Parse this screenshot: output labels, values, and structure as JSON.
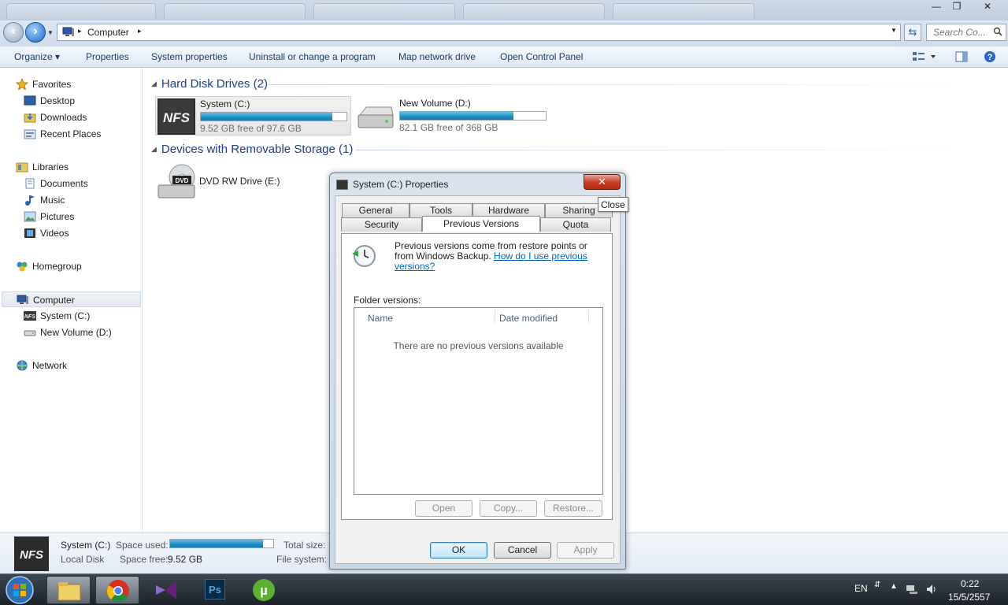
{
  "window": {
    "controls": [
      "—",
      "❐",
      "✕"
    ]
  },
  "address": {
    "crumb": "Computer",
    "search_placeholder": "Search Co..."
  },
  "toolbar": {
    "organize": "Organize ▾",
    "properties": "Properties",
    "system_properties": "System properties",
    "uninstall": "Uninstall or change a program",
    "map_drive": "Map network drive",
    "control_panel": "Open Control Panel"
  },
  "nav": {
    "favorites": "Favorites",
    "desktop": "Desktop",
    "downloads": "Downloads",
    "recent": "Recent Places",
    "libraries": "Libraries",
    "documents": "Documents",
    "music": "Music",
    "pictures": "Pictures",
    "videos": "Videos",
    "homegroup": "Homegroup",
    "computer": "Computer",
    "system_c": "System (C:)",
    "new_volume": "New Volume (D:)",
    "network": "Network"
  },
  "content": {
    "hdd_header": "Hard Disk Drives (2)",
    "removable_header": "Devices with Removable Storage (1)",
    "drives": [
      {
        "name": "System (C:)",
        "free": "9.52 GB free of 97.6 GB",
        "used_fraction": 0.9
      },
      {
        "name": "New Volume (D:)",
        "free": "82.1 GB free of 368 GB",
        "used_fraction": 0.78
      }
    ],
    "dvd": {
      "name": "DVD RW Drive (E:)",
      "badge": "DVD"
    }
  },
  "details": {
    "name": "System (C:)",
    "type": "Local Disk",
    "space_used_label": "Space used:",
    "space_free_label": "Space free:",
    "space_free_value": "9.52 GB",
    "total_size_label": "Total size:",
    "file_system_label": "File system:",
    "used_fraction": 0.9
  },
  "dialog": {
    "title": "System (C:) Properties",
    "close_glyph": "✕",
    "close_tooltip": "Close",
    "tabs_row1": [
      "General",
      "Tools",
      "Hardware",
      "Sharing"
    ],
    "tabs_row2": [
      "Security",
      "Previous Versions",
      "Quota"
    ],
    "info_text": "Previous versions come from restore points or from Windows Backup. ",
    "info_link": "How do I use previous versions?",
    "folder_versions_label": "Folder versions:",
    "columns": [
      "Name",
      "Date modified"
    ],
    "empty_message": "There are no previous versions available",
    "open": "Open",
    "copy": "Copy...",
    "restore": "Restore...",
    "ok": "OK",
    "cancel": "Cancel",
    "apply": "Apply"
  },
  "taskbar": {
    "language": "EN",
    "time": "0:22",
    "date": "15/5/2557"
  }
}
